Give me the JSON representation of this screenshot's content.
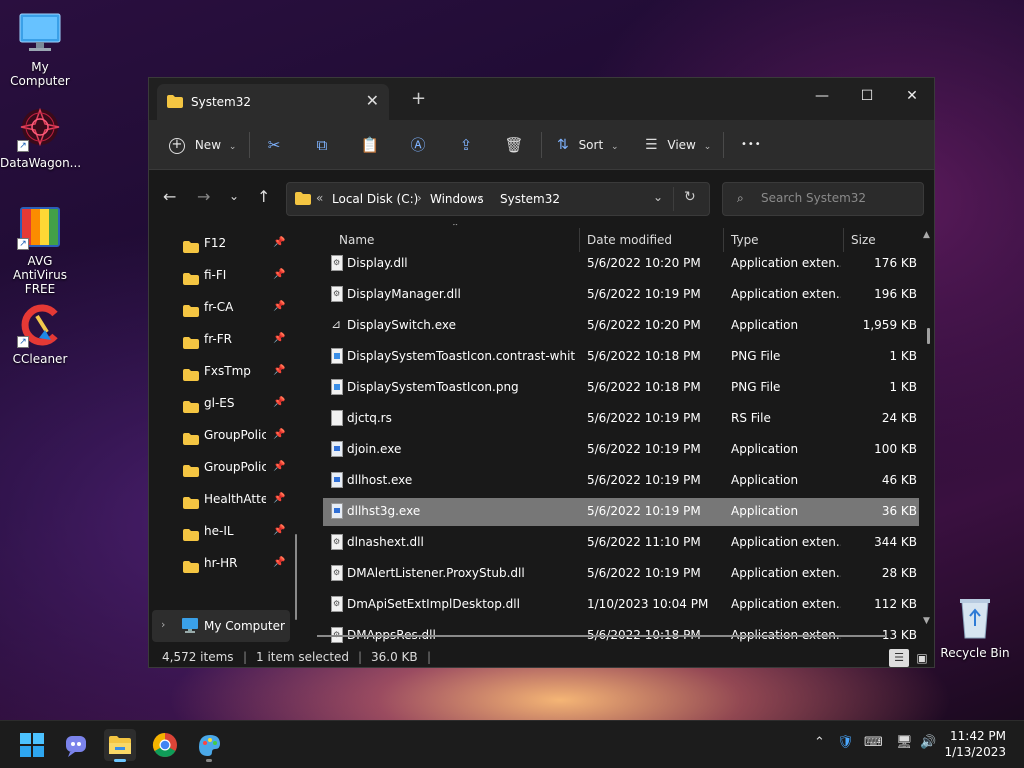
{
  "desktop": {
    "icons": [
      {
        "label": "My Computer"
      },
      {
        "label": "DataWagon..."
      },
      {
        "label": "AVG AntiVirus FREE"
      },
      {
        "label": "CCleaner"
      },
      {
        "label": "Recycle Bin"
      }
    ]
  },
  "window": {
    "tab_title": "System32",
    "tab_close": "✕",
    "new_tab": "+",
    "minimize": "—",
    "maximize": "☐",
    "close": "✕"
  },
  "toolbar": {
    "new_label": "New",
    "sort_label": "Sort",
    "view_label": "View",
    "more_label": "•••"
  },
  "address": {
    "overflow": "«",
    "crumbs": [
      "Local Disk (C:)",
      "Windows",
      "System32"
    ],
    "separator": "›"
  },
  "search": {
    "placeholder": "Search System32"
  },
  "nav": {
    "items": [
      "F12",
      "fi-FI",
      "fr-CA",
      "fr-FR",
      "FxsTmp",
      "gl-ES",
      "GroupPolicy",
      "GroupPolicyUsers",
      "HealthAttestation",
      "he-IL",
      "hr-HR"
    ],
    "my_computer": "My Computer"
  },
  "columns": {
    "name": "Name",
    "date": "Date modified",
    "type": "Type",
    "size": "Size"
  },
  "files": [
    {
      "name": "Display.dll",
      "date": "5/6/2022 10:20 PM",
      "type": "Application exten...",
      "size": "176 KB",
      "icon": "dll"
    },
    {
      "name": "DisplayManager.dll",
      "date": "5/6/2022 10:19 PM",
      "type": "Application exten...",
      "size": "196 KB",
      "icon": "dll"
    },
    {
      "name": "DisplaySwitch.exe",
      "date": "5/6/2022 10:20 PM",
      "type": "Application",
      "size": "1,959 KB",
      "icon": "display"
    },
    {
      "name": "DisplaySystemToastIcon.contrast-white.p...",
      "date": "5/6/2022 10:18 PM",
      "type": "PNG File",
      "size": "1 KB",
      "icon": "png"
    },
    {
      "name": "DisplaySystemToastIcon.png",
      "date": "5/6/2022 10:18 PM",
      "type": "PNG File",
      "size": "1 KB",
      "icon": "png"
    },
    {
      "name": "djctq.rs",
      "date": "5/6/2022 10:19 PM",
      "type": "RS File",
      "size": "24 KB",
      "icon": "blank"
    },
    {
      "name": "djoin.exe",
      "date": "5/6/2022 10:19 PM",
      "type": "Application",
      "size": "100 KB",
      "icon": "app"
    },
    {
      "name": "dllhost.exe",
      "date": "5/6/2022 10:19 PM",
      "type": "Application",
      "size": "46 KB",
      "icon": "app"
    },
    {
      "name": "dllhst3g.exe",
      "date": "5/6/2022 10:19 PM",
      "type": "Application",
      "size": "36 KB",
      "icon": "app",
      "selected": true
    },
    {
      "name": "dlnashext.dll",
      "date": "5/6/2022 11:10 PM",
      "type": "Application exten...",
      "size": "344 KB",
      "icon": "dll"
    },
    {
      "name": "DMAlertListener.ProxyStub.dll",
      "date": "5/6/2022 10:19 PM",
      "type": "Application exten...",
      "size": "28 KB",
      "icon": "dll"
    },
    {
      "name": "DmApiSetExtImplDesktop.dll",
      "date": "1/10/2023 10:04 PM",
      "type": "Application exten...",
      "size": "112 KB",
      "icon": "dll"
    },
    {
      "name": "DMAppsRes.dll",
      "date": "5/6/2022 10:18 PM",
      "type": "Application exten...",
      "size": "13 KB",
      "icon": "dll"
    }
  ],
  "status": {
    "count": "4,572 items",
    "selection": "1 item selected",
    "size": "36.0 KB",
    "sep": "|"
  },
  "clock": {
    "time": "11:42 PM",
    "date": "1/13/2023"
  }
}
